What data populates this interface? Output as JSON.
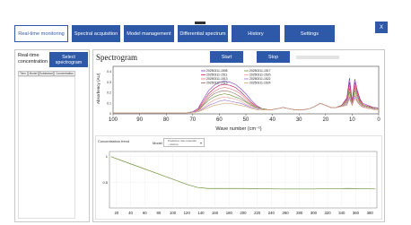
{
  "nav": {
    "tabs": [
      {
        "label": "Real-time monitoring",
        "active": true
      },
      {
        "label": "Spectral acquisition",
        "active": false
      },
      {
        "label": "Model management",
        "active": false
      },
      {
        "label": "Differential spectrum",
        "active": false
      },
      {
        "label": "History",
        "active": false
      },
      {
        "label": "Settings",
        "active": false
      }
    ],
    "close_label": "X"
  },
  "left_panel": {
    "title": "Real-time concentration",
    "select_button": "Select spectrogram",
    "table_headers": [
      "Time",
      "Model",
      "Substance",
      "Concentration"
    ]
  },
  "spectrogram": {
    "title": "Spectrogram",
    "start_label": "Start",
    "stop_label": "Stop",
    "ylabel": "Absorbency (AU)",
    "xlabel": "Wave number (cm⁻¹)",
    "x_ticks": [
      "100",
      "90",
      "80",
      "70",
      "60",
      "50",
      "40",
      "30",
      "20",
      "10",
      "0"
    ],
    "y_ticks": [
      "0.4",
      "0.3",
      "0.2",
      "0.1",
      "0"
    ],
    "legend": [
      "20250311-1508",
      "20250311-1511",
      "20250311-1513",
      "20250311-1516",
      "20250311-1517",
      "20250311-1520",
      "20250311-1522",
      "20250311-1524"
    ]
  },
  "trend": {
    "title": "Concentration trend",
    "model_label": "Model",
    "model_value": "Predictive raw materials - mixture",
    "y_ticks": [
      "1",
      "0.5"
    ],
    "x_ticks": [
      "20",
      "40",
      "60",
      "80",
      "100",
      "120",
      "140",
      "160",
      "180",
      "200",
      "220",
      "240",
      "260",
      "280",
      "300",
      "320",
      "340",
      "360",
      "380"
    ]
  },
  "chart_data": [
    {
      "type": "line",
      "title": "Spectrogram",
      "xlabel": "Wave number (cm⁻¹)",
      "ylabel": "Absorbency (AU)",
      "xlim": [
        100,
        0
      ],
      "ylim": [
        0,
        0.45
      ],
      "grid": false,
      "legend_position": "top-center",
      "x": [
        100,
        90,
        80,
        72,
        70,
        68,
        66,
        64,
        62,
        60,
        58,
        56,
        54,
        52,
        50,
        48,
        46,
        44,
        42,
        40,
        38,
        36,
        34,
        32,
        30,
        28,
        26,
        24,
        22,
        20,
        18,
        16,
        14,
        12,
        11,
        10,
        9,
        8,
        7,
        6,
        5,
        4,
        3,
        2,
        1,
        0
      ],
      "series": [
        {
          "name": "20250311-1508",
          "values": [
            0.01,
            0.01,
            0.01,
            0.01,
            0.02,
            0.05,
            0.14,
            0.22,
            0.27,
            0.3,
            0.31,
            0.3,
            0.28,
            0.24,
            0.19,
            0.13,
            0.08,
            0.05,
            0.04,
            0.04,
            0.05,
            0.06,
            0.05,
            0.04,
            0.04,
            0.04,
            0.05,
            0.07,
            0.1,
            0.08,
            0.06,
            0.06,
            0.08,
            0.15,
            0.34,
            0.12,
            0.33,
            0.22,
            0.14,
            0.1,
            0.09,
            0.08,
            0.07,
            0.06,
            0.06,
            0.05
          ]
        },
        {
          "name": "20250311-1511",
          "values": [
            0.01,
            0.01,
            0.01,
            0.01,
            0.02,
            0.04,
            0.12,
            0.19,
            0.24,
            0.27,
            0.28,
            0.27,
            0.25,
            0.21,
            0.16,
            0.11,
            0.07,
            0.05,
            0.04,
            0.04,
            0.05,
            0.06,
            0.05,
            0.04,
            0.04,
            0.04,
            0.05,
            0.07,
            0.1,
            0.08,
            0.06,
            0.06,
            0.08,
            0.14,
            0.3,
            0.11,
            0.3,
            0.2,
            0.13,
            0.09,
            0.08,
            0.07,
            0.07,
            0.06,
            0.05,
            0.05
          ]
        },
        {
          "name": "20250311-1513",
          "values": [
            0.01,
            0.01,
            0.01,
            0.01,
            0.02,
            0.04,
            0.1,
            0.17,
            0.21,
            0.24,
            0.25,
            0.24,
            0.22,
            0.19,
            0.14,
            0.1,
            0.07,
            0.05,
            0.04,
            0.04,
            0.05,
            0.06,
            0.05,
            0.04,
            0.04,
            0.04,
            0.05,
            0.07,
            0.1,
            0.08,
            0.06,
            0.06,
            0.08,
            0.13,
            0.27,
            0.1,
            0.27,
            0.18,
            0.12,
            0.09,
            0.08,
            0.07,
            0.06,
            0.06,
            0.05,
            0.05
          ]
        },
        {
          "name": "20250311-1516",
          "values": [
            0.01,
            0.01,
            0.01,
            0.01,
            0.02,
            0.03,
            0.09,
            0.15,
            0.19,
            0.21,
            0.22,
            0.21,
            0.19,
            0.16,
            0.12,
            0.09,
            0.06,
            0.05,
            0.04,
            0.04,
            0.05,
            0.06,
            0.05,
            0.04,
            0.04,
            0.04,
            0.05,
            0.07,
            0.1,
            0.08,
            0.06,
            0.06,
            0.08,
            0.12,
            0.24,
            0.1,
            0.25,
            0.17,
            0.11,
            0.08,
            0.07,
            0.07,
            0.06,
            0.06,
            0.05,
            0.05
          ]
        },
        {
          "name": "20250311-1517",
          "values": [
            0.01,
            0.01,
            0.01,
            0.01,
            0.02,
            0.03,
            0.08,
            0.13,
            0.16,
            0.18,
            0.19,
            0.18,
            0.16,
            0.14,
            0.11,
            0.08,
            0.06,
            0.05,
            0.04,
            0.04,
            0.05,
            0.06,
            0.05,
            0.04,
            0.04,
            0.04,
            0.05,
            0.07,
            0.1,
            0.08,
            0.06,
            0.06,
            0.07,
            0.11,
            0.21,
            0.09,
            0.22,
            0.15,
            0.1,
            0.08,
            0.07,
            0.06,
            0.06,
            0.05,
            0.05,
            0.05
          ]
        },
        {
          "name": "20250311-1520",
          "values": [
            0.01,
            0.01,
            0.01,
            0.01,
            0.02,
            0.03,
            0.06,
            0.1,
            0.13,
            0.15,
            0.16,
            0.15,
            0.14,
            0.12,
            0.09,
            0.07,
            0.05,
            0.04,
            0.04,
            0.04,
            0.05,
            0.06,
            0.05,
            0.04,
            0.04,
            0.04,
            0.05,
            0.07,
            0.1,
            0.08,
            0.06,
            0.06,
            0.07,
            0.1,
            0.18,
            0.09,
            0.19,
            0.13,
            0.09,
            0.07,
            0.06,
            0.06,
            0.05,
            0.05,
            0.05,
            0.04
          ]
        },
        {
          "name": "20250311-1522",
          "values": [
            0.01,
            0.01,
            0.01,
            0.01,
            0.02,
            0.02,
            0.05,
            0.08,
            0.1,
            0.12,
            0.13,
            0.12,
            0.11,
            0.1,
            0.08,
            0.06,
            0.05,
            0.04,
            0.04,
            0.04,
            0.05,
            0.06,
            0.05,
            0.04,
            0.04,
            0.04,
            0.05,
            0.07,
            0.1,
            0.08,
            0.06,
            0.06,
            0.07,
            0.09,
            0.16,
            0.08,
            0.17,
            0.12,
            0.08,
            0.07,
            0.06,
            0.05,
            0.05,
            0.05,
            0.04,
            0.04
          ]
        },
        {
          "name": "20250311-1524",
          "values": [
            0.01,
            0.01,
            0.01,
            0.01,
            0.01,
            0.02,
            0.04,
            0.06,
            0.08,
            0.09,
            0.1,
            0.1,
            0.09,
            0.08,
            0.07,
            0.05,
            0.04,
            0.04,
            0.04,
            0.04,
            0.05,
            0.06,
            0.05,
            0.04,
            0.04,
            0.04,
            0.05,
            0.07,
            0.1,
            0.08,
            0.06,
            0.06,
            0.07,
            0.08,
            0.14,
            0.08,
            0.15,
            0.11,
            0.08,
            0.06,
            0.06,
            0.05,
            0.05,
            0.04,
            0.04,
            0.04
          ]
        }
      ],
      "colors": [
        "#7b3fbf",
        "#c2185b",
        "#e57373",
        "#8d6e63",
        "#6d8f3a",
        "#ef9a9a",
        "#9575cd",
        "#d4a373"
      ]
    },
    {
      "type": "line",
      "title": "Concentration trend",
      "ylim": [
        0,
        1.1
      ],
      "xlim": [
        10,
        390
      ],
      "grid": true,
      "x": [
        12,
        40,
        80,
        120,
        135,
        150,
        200,
        250,
        300,
        350,
        388
      ],
      "series": [
        {
          "values": [
            1.0,
            0.86,
            0.66,
            0.46,
            0.4,
            0.38,
            0.38,
            0.37,
            0.37,
            0.38,
            0.37
          ]
        }
      ],
      "colors": [
        "#6d8f3a"
      ]
    }
  ]
}
